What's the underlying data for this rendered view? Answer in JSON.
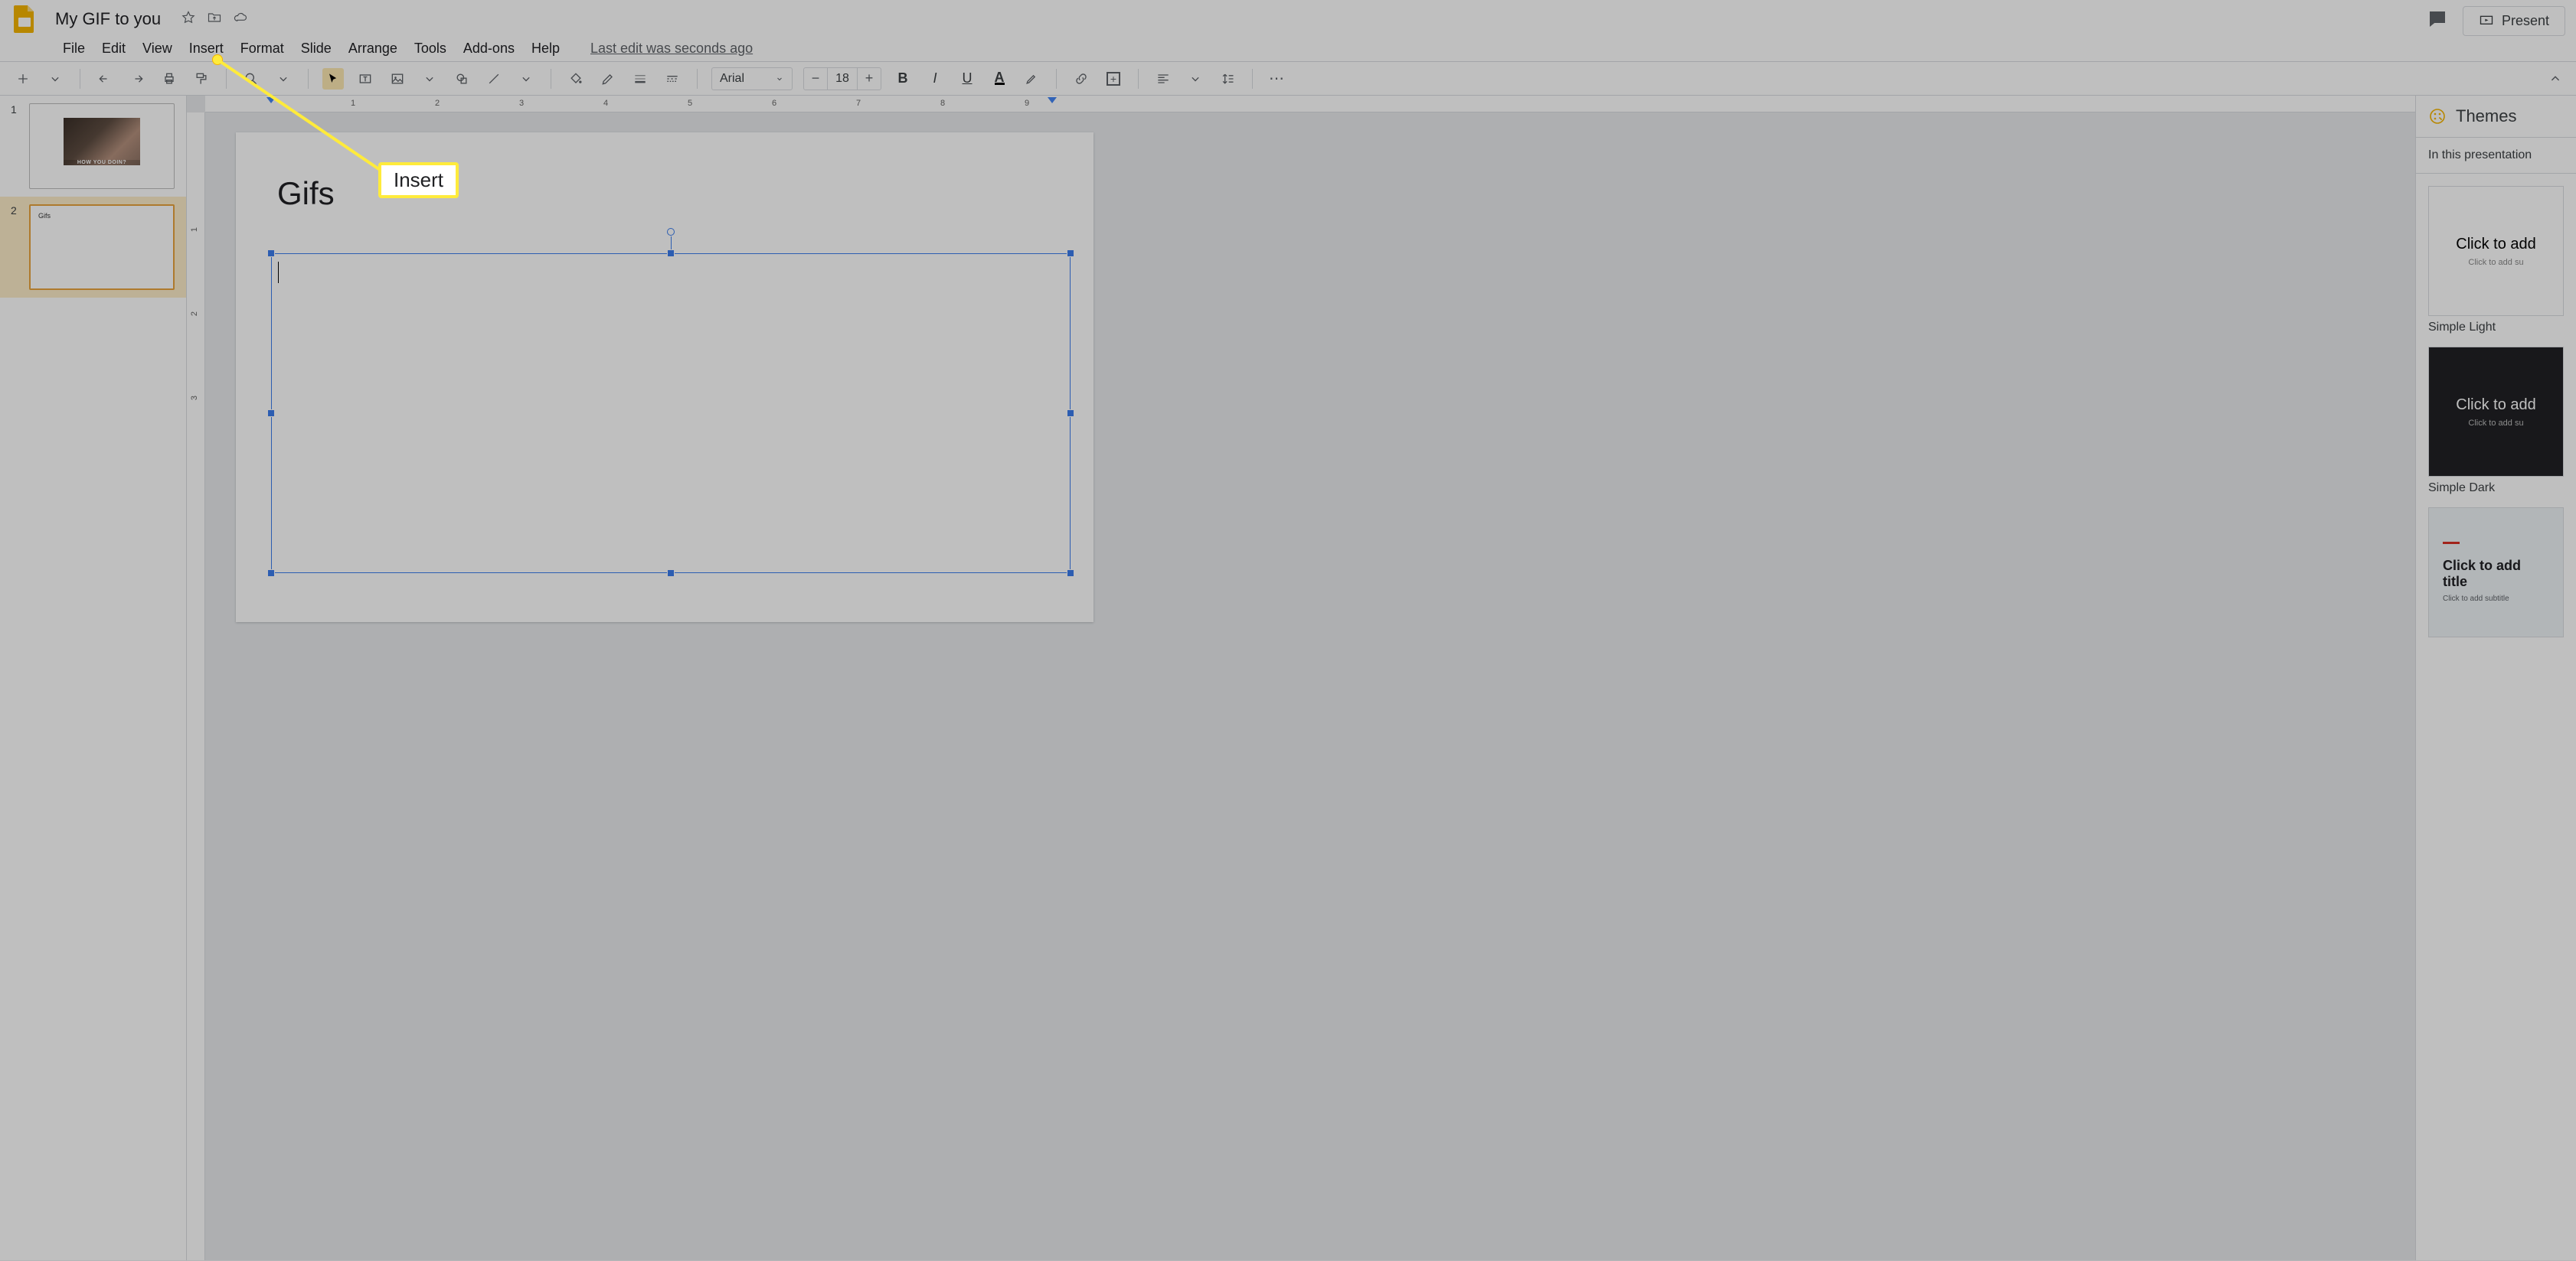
{
  "app": {
    "title": "My GIF to you"
  },
  "titlebar_icons": [
    "star-icon",
    "move-to-folder-icon",
    "cloud-saved-icon"
  ],
  "present_button": "Present",
  "menubar": {
    "items": [
      "File",
      "Edit",
      "View",
      "Insert",
      "Format",
      "Slide",
      "Arrange",
      "Tools",
      "Add-ons",
      "Help"
    ],
    "edit_status": "Last edit was seconds ago"
  },
  "toolbar": {
    "font_name": "Arial",
    "font_size": "18"
  },
  "thumbnails": [
    {
      "num": "1",
      "caption": "HOW YOU DOIN?"
    },
    {
      "num": "2",
      "label": "Gifs"
    }
  ],
  "ruler_h": [
    "1",
    "2",
    "3",
    "4",
    "5",
    "6",
    "7",
    "8",
    "9"
  ],
  "ruler_v": [
    "1",
    "2",
    "3"
  ],
  "slide": {
    "title": "Gifs"
  },
  "themes": {
    "heading": "Themes",
    "subheading": "In this presentation",
    "items": [
      {
        "title": "Click to add",
        "sub": "Click to add su",
        "name": "Simple Light",
        "variant": "light"
      },
      {
        "title": "Click to add",
        "sub": "Click to add su",
        "name": "Simple Dark",
        "variant": "dark"
      },
      {
        "title": "Click to add title",
        "sub": "Click to add subtitle",
        "name": "",
        "variant": "titleslide"
      }
    ]
  },
  "callout": {
    "label": "Insert"
  }
}
